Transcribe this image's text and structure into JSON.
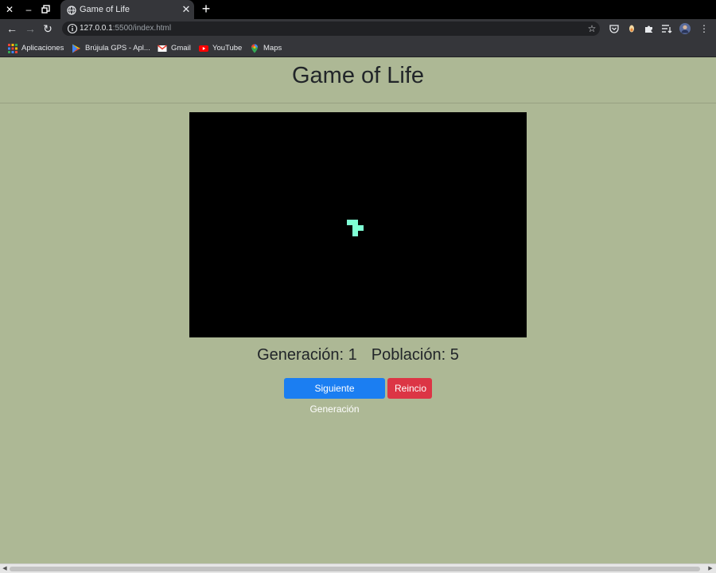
{
  "browser": {
    "tab": {
      "title": "Game of Life",
      "favicon": "globe-icon"
    },
    "address": {
      "host": "127.0.0.1",
      "rest": ":5500/index.html"
    },
    "bookmarks": [
      {
        "label": "Aplicaciones",
        "icon": "apps-grid-icon"
      },
      {
        "label": "Brújula GPS - Apl...",
        "icon": "play-store-icon"
      },
      {
        "label": "Gmail",
        "icon": "gmail-icon"
      },
      {
        "label": "YouTube",
        "icon": "youtube-icon"
      },
      {
        "label": "Maps",
        "icon": "maps-pin-icon"
      }
    ]
  },
  "page": {
    "title": "Game of Life",
    "stats": {
      "generation_label": "Generación:",
      "generation_value": "1",
      "population_label": "Población:",
      "population_value": "5"
    },
    "buttons": {
      "next": "Siguiente Generación",
      "reset": "Reincio"
    },
    "board": {
      "cell_color": "#7fffd4",
      "background": "#000000",
      "live_cells": [
        {
          "row": 0,
          "col": 0
        },
        {
          "row": 0,
          "col": 1
        },
        {
          "row": 1,
          "col": 1
        },
        {
          "row": 1,
          "col": 2
        },
        {
          "row": 2,
          "col": 1
        }
      ]
    }
  },
  "colors": {
    "page_background": "#adb895",
    "next_button": "#1b7ef2",
    "reset_button": "#dc3545"
  }
}
